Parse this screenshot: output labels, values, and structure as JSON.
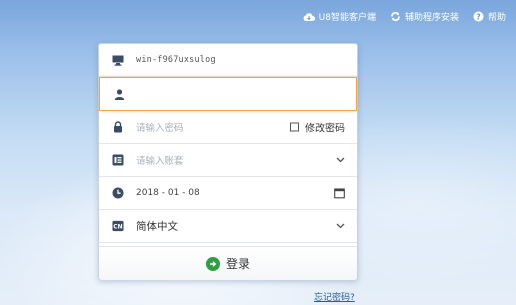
{
  "topbar": {
    "client_label": "U8智能客户端",
    "installer_label": "辅助程序安装",
    "help_label": "帮助"
  },
  "login": {
    "server_value": "win-f967uxsulog",
    "username_value": "",
    "password_placeholder": "请输入密码",
    "change_password_label": "修改密码",
    "account_placeholder": "请输入账套",
    "date_value": "2018 - 01 - 08",
    "language_badge": "CN",
    "language_value": "简体中文",
    "login_button_label": "登录",
    "forgot_password_label": "忘记密码?"
  },
  "colors": {
    "focus_border": "#f0a640",
    "login_icon": "#2f9e44",
    "link": "#2a5d9c"
  },
  "icons": [
    "cloud-icon",
    "refresh-icon",
    "help-icon",
    "monitor-icon",
    "user-icon",
    "lock-icon",
    "account-icon",
    "clock-icon",
    "language-icon",
    "calendar-icon",
    "chevron-down-icon",
    "arrow-right-icon"
  ]
}
